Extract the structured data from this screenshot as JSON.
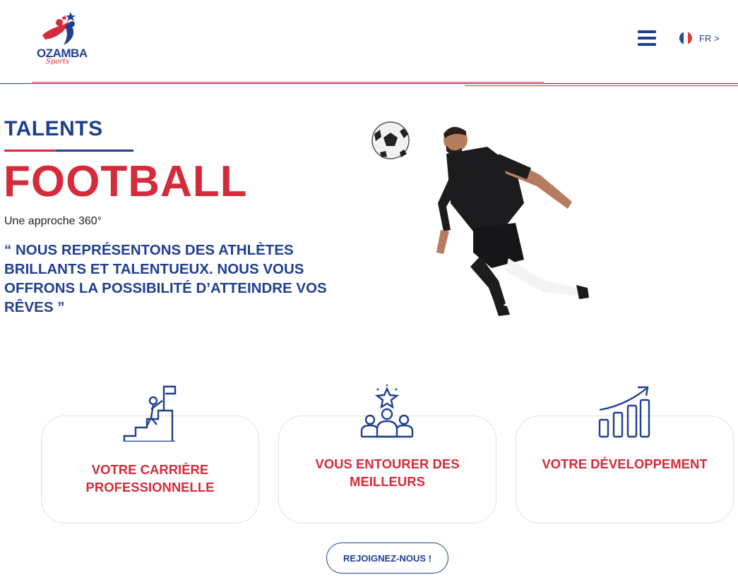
{
  "header": {
    "logo_text": "OZAMBA",
    "logo_script": "Sports",
    "menu_icon": "hamburger-menu-icon",
    "language": {
      "flag_icon": "france-flag-icon",
      "label": "FR >"
    }
  },
  "hero": {
    "eyebrow": "TALENTS",
    "title": "FOOTBALL",
    "subtitle": "Une approche 360°",
    "quote": "“ NOUS REPRÉSENTONS DES ATHLÈTES BRILLANTS ET TALENTUEUX. NOUS VOUS OFFRONS LA POSSIBILITÉ D’ATTEINDRE VOS RÊVES ”",
    "image_icon": "football-player-heading-ball-photo"
  },
  "cards": [
    {
      "icon": "career-stairs-flag-icon",
      "title": "VOTRE CARRIÈRE PROFESSIONNELLE"
    },
    {
      "icon": "team-star-icon",
      "title": "VOUS ENTOURER DES MEILLEURS"
    },
    {
      "icon": "growth-chart-icon",
      "title": "VOTRE DÉVELOPPEMENT"
    }
  ],
  "cta_label": "REJOIGNEZ-NOUS !",
  "colors": {
    "brand_blue": "#1f3f8f",
    "brand_red": "#d52b3a"
  }
}
